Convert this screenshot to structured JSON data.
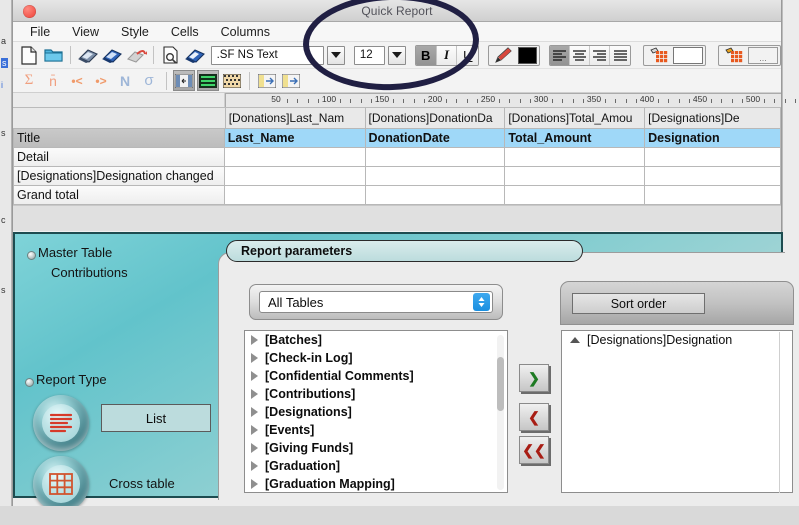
{
  "window": {
    "title": "Quick Report",
    "close_icon": "close-button"
  },
  "menubar": {
    "items": [
      {
        "label": "File"
      },
      {
        "label": "View"
      },
      {
        "label": "Style"
      },
      {
        "label": "Cells"
      },
      {
        "label": "Columns"
      }
    ]
  },
  "toolbar": {
    "icons_row1": [
      {
        "name": "new-document-icon"
      },
      {
        "name": "open-folder-icon"
      },
      {
        "name": "save-icon"
      },
      {
        "name": "save-as-icon"
      },
      {
        "name": "revert-icon"
      },
      {
        "name": "print-preview-icon"
      },
      {
        "name": "print-icon"
      }
    ],
    "font_name": ".SF NS Text",
    "font_size": "12",
    "bold_label": "B",
    "italic_label": "I",
    "underline_label": "U",
    "pen_icon": "pen-color-icon",
    "text_color_swatch": "#000000",
    "align_left_icon": "align-left-icon",
    "align_center_icon": "align-center-icon",
    "align_right_icon": "align-right-icon",
    "align_justify_icon": "align-justify-icon",
    "fill_color_icon": "fill-bucket-icon",
    "fill_color_swatch": "#ffffff",
    "pattern_icon": "pattern-bucket-icon",
    "pattern_value": "...",
    "icons_row2": [
      {
        "name": "sum-icon",
        "glyph": "Σ"
      },
      {
        "name": "average-icon",
        "glyph": "n̄"
      },
      {
        "name": "minimum-icon",
        "glyph": "•<"
      },
      {
        "name": "maximum-icon",
        "glyph": "•>"
      },
      {
        "name": "count-icon",
        "glyph": "N"
      },
      {
        "name": "std-deviation-icon",
        "glyph": "σ"
      },
      {
        "name": "hide-show-columns-icon"
      },
      {
        "name": "table-view-icon"
      },
      {
        "name": "pattern-grid-icon"
      },
      {
        "name": "insert-column-left-icon"
      },
      {
        "name": "insert-column-right-icon"
      }
    ]
  },
  "ruler": {
    "unit_ticks": [
      50,
      100,
      150,
      200,
      250,
      300,
      350,
      400,
      450,
      500
    ]
  },
  "report_grid": {
    "column_headers": [
      "[Donations]Last_Nam",
      "[Donations]DonationDa",
      "[Donations]Total_Amou",
      "[Designations]De"
    ],
    "rows": [
      {
        "label": "Title",
        "style": "title",
        "cells": [
          "Last_Name",
          "DonationDate",
          "Total_Amount",
          "Designation"
        ],
        "highlight": true
      },
      {
        "label": "Detail",
        "style": "plain",
        "cells": [
          "",
          "",
          "",
          ""
        ],
        "highlight": false
      },
      {
        "label": "[Designations]Designation changed",
        "style": "plain",
        "cells": [
          "",
          "",
          "",
          ""
        ],
        "highlight": false
      },
      {
        "label": "Grand total",
        "style": "plain",
        "cells": [
          "",
          "",
          "",
          ""
        ],
        "highlight": false
      }
    ]
  },
  "lower_panel": {
    "report_parameters_tab": "Report parameters",
    "master_table_label": "Master Table",
    "master_table_value": "Contributions",
    "report_type_label": "Report Type",
    "report_type_options": [
      {
        "label": "List",
        "icon": "list-report-icon",
        "selected": true
      },
      {
        "label": "Cross table",
        "icon": "cross-table-report-icon",
        "selected": false
      }
    ],
    "tables_filter": "All Tables",
    "tables_list": [
      "[Batches]",
      "[Check-in Log]",
      "[Confidential Comments]",
      "[Contributions]",
      "[Designations]",
      "[Events]",
      "[Giving Funds]",
      "[Graduation]",
      "[Graduation Mapping]"
    ],
    "transfer_buttons": [
      {
        "name": "add-field-button",
        "glyph": "❯"
      },
      {
        "name": "remove-field-button",
        "glyph": "❮"
      },
      {
        "name": "remove-all-fields-button",
        "glyph": "❮❮"
      }
    ],
    "sort_order_label": "Sort order",
    "sort_order_items": [
      {
        "field": "[Designations]Designation",
        "direction": "ascending"
      }
    ]
  },
  "annotation": {
    "name": "highlight-oval",
    "color": "#201f43"
  },
  "background_window": {
    "left_edge_fragments": [
      "a",
      "s",
      "i",
      "s",
      "c",
      "s"
    ]
  }
}
